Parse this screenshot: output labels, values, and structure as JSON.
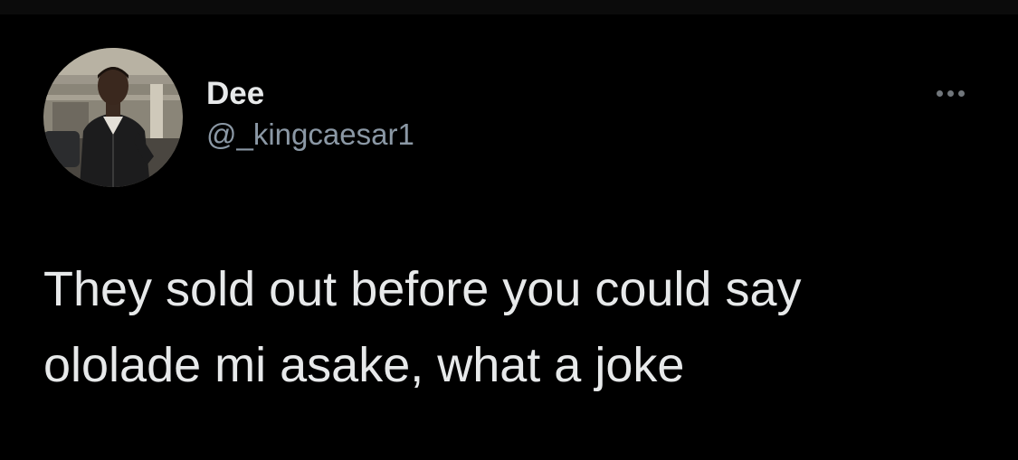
{
  "author": {
    "display_name": "Dee",
    "handle": "@_kingcaesar1"
  },
  "more_icon": "more-horizontal-icon",
  "avatar_icon": "profile-photo",
  "tweet": {
    "text": "They sold out before you could say\nololade mi asake, what a joke"
  },
  "colors": {
    "background": "#000000",
    "primary_text": "#e7e9ea",
    "secondary_text": "#8b98a5"
  }
}
